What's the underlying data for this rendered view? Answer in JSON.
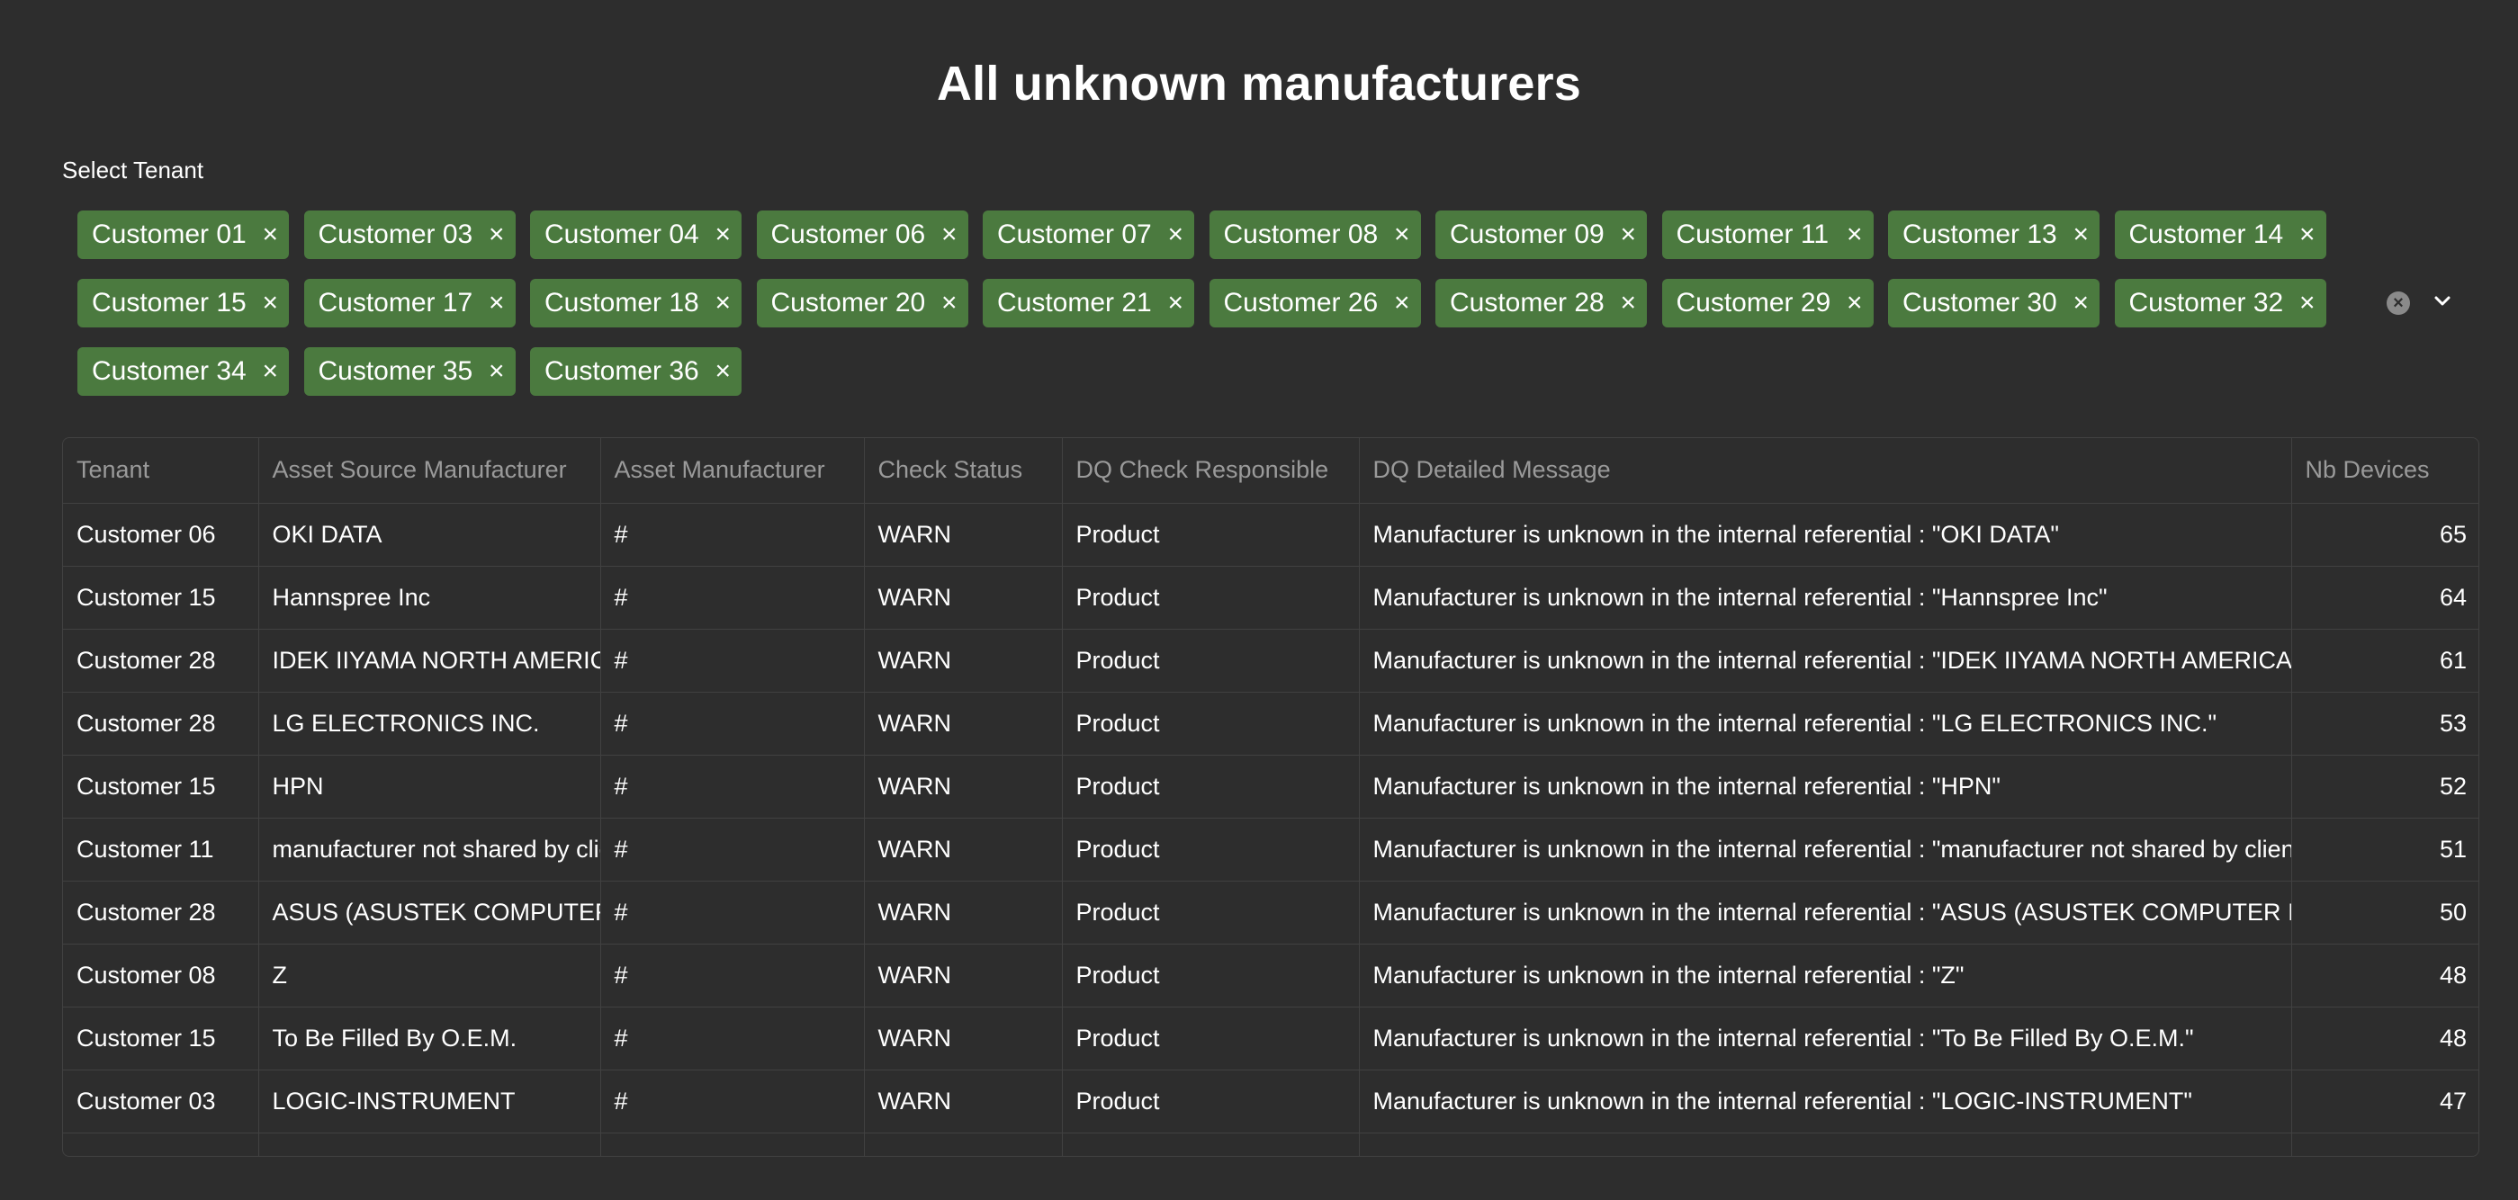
{
  "page": {
    "title": "All unknown manufacturers"
  },
  "tenant_select": {
    "label": "Select Tenant",
    "selected": [
      "Customer 01",
      "Customer 03",
      "Customer 04",
      "Customer 06",
      "Customer 07",
      "Customer 08",
      "Customer 09",
      "Customer 11",
      "Customer 13",
      "Customer 14",
      "Customer 15",
      "Customer 17",
      "Customer 18",
      "Customer 20",
      "Customer 21",
      "Customer 26",
      "Customer 28",
      "Customer 29",
      "Customer 30",
      "Customer 32",
      "Customer 34",
      "Customer 35",
      "Customer 36"
    ],
    "remove_glyph": "×",
    "clear_glyph": "×",
    "caret_icon": "chevron-down-icon"
  },
  "table": {
    "columns": [
      "Tenant",
      "Asset Source Manufacturer",
      "Asset Manufacturer",
      "Check Status",
      "DQ Check Responsible",
      "DQ Detailed Message",
      "Nb Devices"
    ],
    "rows": [
      [
        "Customer 06",
        "OKI DATA",
        "#",
        "WARN",
        "Product",
        "Manufacturer is unknown in the internal referential : \"OKI DATA\"",
        "65"
      ],
      [
        "Customer 15",
        "Hannspree Inc",
        "#",
        "WARN",
        "Product",
        "Manufacturer is unknown in the internal referential : \"Hannspree Inc\"",
        "64"
      ],
      [
        "Customer 28",
        "IDEK IIYAMA NORTH AMERICA",
        "#",
        "WARN",
        "Product",
        "Manufacturer is unknown in the internal referential : \"IDEK IIYAMA NORTH AMERICA\"",
        "61"
      ],
      [
        "Customer 28",
        "LG ELECTRONICS INC.",
        "#",
        "WARN",
        "Product",
        "Manufacturer is unknown in the internal referential : \"LG ELECTRONICS INC.\"",
        "53"
      ],
      [
        "Customer 15",
        "HPN",
        "#",
        "WARN",
        "Product",
        "Manufacturer is unknown in the internal referential : \"HPN\"",
        "52"
      ],
      [
        "Customer 11",
        "manufacturer not shared by client",
        "#",
        "WARN",
        "Product",
        "Manufacturer is unknown in the internal referential : \"manufacturer not shared by client\"",
        "51"
      ],
      [
        "Customer 28",
        "ASUS (ASUSTEK COMPUTER INC.)",
        "#",
        "WARN",
        "Product",
        "Manufacturer is unknown in the internal referential : \"ASUS (ASUSTEK COMPUTER INC.)\"",
        "50"
      ],
      [
        "Customer 08",
        "Z",
        "#",
        "WARN",
        "Product",
        "Manufacturer is unknown in the internal referential : \"Z\"",
        "48"
      ],
      [
        "Customer 15",
        "To Be Filled By O.E.M.",
        "#",
        "WARN",
        "Product",
        "Manufacturer is unknown in the internal referential : \"To Be Filled By O.E.M.\"",
        "48"
      ],
      [
        "Customer 03",
        "LOGIC-INSTRUMENT",
        "#",
        "WARN",
        "Product",
        "Manufacturer is unknown in the internal referential : \"LOGIC-INSTRUMENT\"",
        "47"
      ]
    ]
  },
  "colors": {
    "background": "#2d2d2d",
    "chip": "#4b7a3f",
    "grid": "#414141",
    "header_text": "#9a9a9a"
  }
}
